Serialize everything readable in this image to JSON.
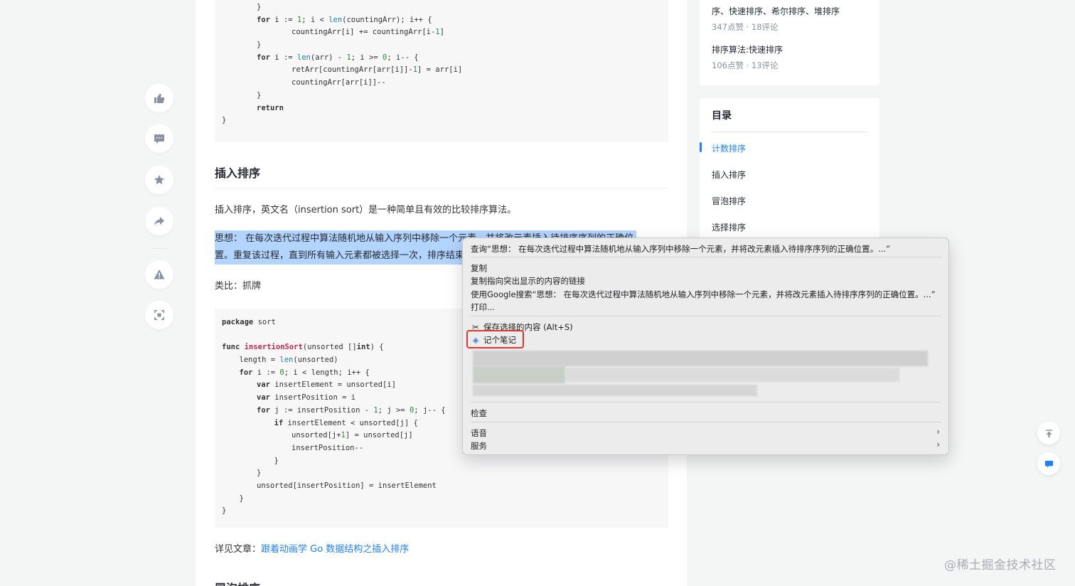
{
  "rail": {
    "icons": [
      "thumbs-up-icon",
      "comment-icon",
      "star-icon",
      "share-icon",
      "report-icon",
      "fullscreen-icon"
    ]
  },
  "article": {
    "code1_lines": [
      {
        "indent": 2,
        "html": "}"
      },
      {
        "indent": 2,
        "html": "<b>for</b> i := <span class='kw-num'>1</span>; i &lt; <span class='kw-bi'>len</span>(countingArr); i++ {"
      },
      {
        "indent": 4,
        "html": "countingArr[i] += countingArr[i-<span class='kw-num'>1</span>]"
      },
      {
        "indent": 2,
        "html": "}"
      },
      {
        "indent": 2,
        "html": "<b>for</b> i := <span class='kw-bi'>len</span>(arr) - <span class='kw-num'>1</span>; i &gt;= <span class='kw-num'>0</span>; i-- {"
      },
      {
        "indent": 4,
        "html": "retArr[countingArr[arr[i]]-<span class='kw-num'>1</span>] = arr[i]"
      },
      {
        "indent": 4,
        "html": "countingArr[arr[i]]--"
      },
      {
        "indent": 2,
        "html": "}"
      },
      {
        "indent": 2,
        "html": "<b>return</b>"
      },
      {
        "indent": 0,
        "html": "}"
      }
    ],
    "heading_insertion": "插入排序",
    "para_intro": "插入排序，英文名（insertion sort）是一种简单且有效的比较排序算法。",
    "selected_line1": "思想： 在每次迭代过程中算法随机地从输入序列中移除一个元素，并将改元素插入待排序序列的正确位",
    "selected_line2": "置。重复该过程，直到所有输入元素都被选择一次，排序结束。",
    "para_analogy": "类比：抓牌",
    "code2_lines": [
      {
        "indent": 0,
        "html": "<b>package</b> sort"
      },
      {
        "indent": 0,
        "html": ""
      },
      {
        "indent": 0,
        "html": "<b>func</b> <span class='kw-fn'>insertionSort</span>(unsorted []<b>int</b>) {"
      },
      {
        "indent": 1,
        "html": "length = <span class='kw-bi'>len</span>(unsorted)"
      },
      {
        "indent": 1,
        "html": "<b>for</b> i := <span class='kw-num'>0</span>; i &lt; length; i++ {"
      },
      {
        "indent": 2,
        "html": "<b>var</b> insertElement = unsorted[i]"
      },
      {
        "indent": 2,
        "html": "<b>var</b> insertPosition = i"
      },
      {
        "indent": 2,
        "html": "<b>for</b> j := insertPosition - <span class='kw-num'>1</span>; j &gt;= <span class='kw-num'>0</span>; j-- {"
      },
      {
        "indent": 3,
        "html": "<b>if</b> insertElement &lt; unsorted[j] {"
      },
      {
        "indent": 4,
        "html": "unsorted[j+<span class='kw-num'>1</span>] = unsorted[j]"
      },
      {
        "indent": 4,
        "html": "insertPosition--"
      },
      {
        "indent": 3,
        "html": "}"
      },
      {
        "indent": 2,
        "html": "}"
      },
      {
        "indent": 2,
        "html": "unsorted[insertPosition] = insertElement"
      },
      {
        "indent": 1,
        "html": "}"
      },
      {
        "indent": 0,
        "html": "}"
      }
    ],
    "see_more_prefix": "详见文章：",
    "see_more_link": "跟着动画学 Go 数据结构之插入排序",
    "heading_bubble": "冒泡排序"
  },
  "related": {
    "items": [
      {
        "title": "序、快速排序、希尔排序、堆排序",
        "meta": "347点赞 · 18评论"
      },
      {
        "title": "排序算法:快速排序",
        "meta": "106点赞 · 13评论"
      }
    ]
  },
  "toc": {
    "title": "目录",
    "items": [
      "计数排序",
      "插入排序",
      "冒泡排序",
      "选择排序"
    ]
  },
  "context_menu": {
    "lookup": "查询“思想： 在每次迭代过程中算法随机地从输入序列中移除一个元素，并将改元素插入待排序序列的正确位置。...”",
    "copy": "复制",
    "copy_link": "复制指向突出显示的内容的链接",
    "google_search": "使用Google搜索“思想： 在每次迭代过程中算法随机地从输入序列中移除一个元素，并将改元素插入待排序序列的正确位置。...”",
    "print": "打印...",
    "save_selection": "保存选择的内容 (Alt+S)",
    "take_note": "记个笔记",
    "inspect": "检查",
    "speech": "语音",
    "services": "服务"
  },
  "watermark": "@稀土掘金技术社区",
  "colors": {
    "accent": "#1e80ff",
    "highlight_box": "#e0362c",
    "selection": "#b3d4fc"
  }
}
